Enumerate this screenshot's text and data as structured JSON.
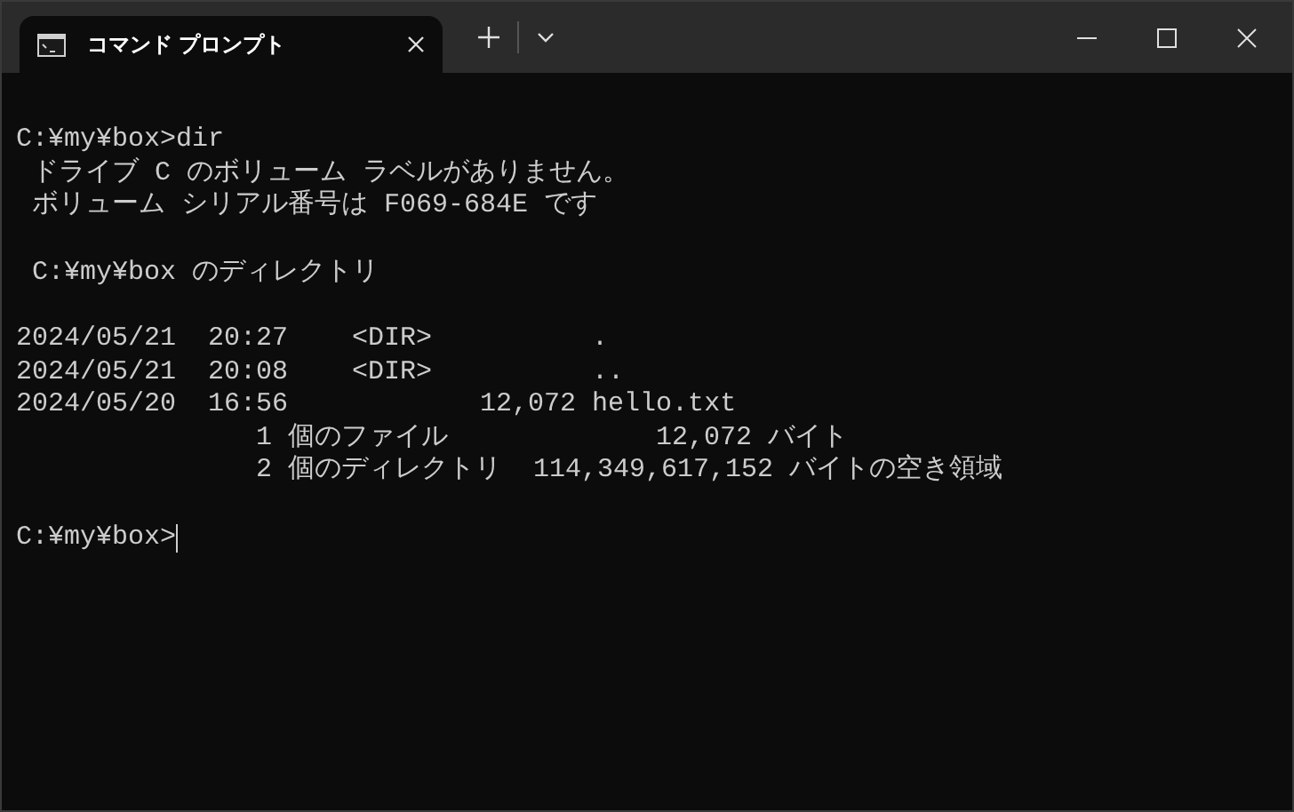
{
  "tab": {
    "title": "コマンド プロンプト",
    "selected": true
  },
  "output_blocks": [
    [
      "C:¥my¥box>dir",
      " ドライブ C のボリューム ラベルがありません。",
      " ボリューム シリアル番号は F069-684E です"
    ],
    [
      " C:¥my¥box のディレクトリ"
    ],
    [
      "2024/05/21  20:27    <DIR>          .",
      "2024/05/21  20:08    <DIR>          ..",
      "2024/05/20  16:56            12,072 hello.txt",
      "               1 個のファイル             12,072 バイト",
      "               2 個のディレクトリ  114,349,617,152 バイトの空き領域"
    ]
  ],
  "prompt": {
    "text": "C:¥my¥box>",
    "cursor": true
  }
}
